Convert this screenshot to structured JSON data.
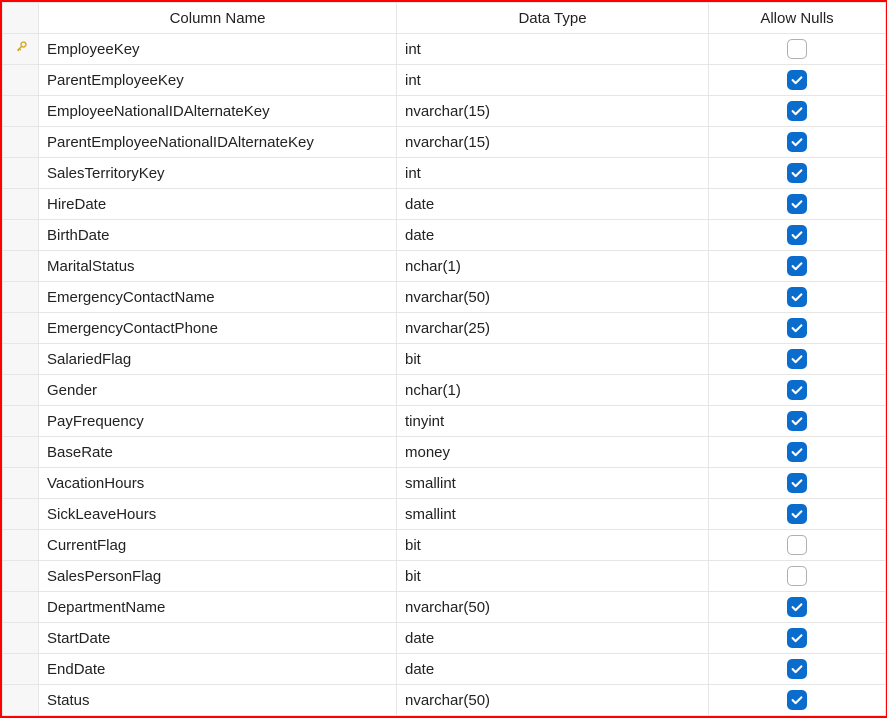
{
  "headers": {
    "columnName": "Column Name",
    "dataType": "Data Type",
    "allowNulls": "Allow Nulls"
  },
  "rows": [
    {
      "isKey": true,
      "name": "EmployeeKey",
      "type": "int",
      "allowNulls": false
    },
    {
      "isKey": false,
      "name": "ParentEmployeeKey",
      "type": "int",
      "allowNulls": true
    },
    {
      "isKey": false,
      "name": "EmployeeNationalIDAlternateKey",
      "type": "nvarchar(15)",
      "allowNulls": true
    },
    {
      "isKey": false,
      "name": "ParentEmployeeNationalIDAlternateKey",
      "type": "nvarchar(15)",
      "allowNulls": true
    },
    {
      "isKey": false,
      "name": "SalesTerritoryKey",
      "type": "int",
      "allowNulls": true
    },
    {
      "isKey": false,
      "name": "HireDate",
      "type": "date",
      "allowNulls": true
    },
    {
      "isKey": false,
      "name": "BirthDate",
      "type": "date",
      "allowNulls": true
    },
    {
      "isKey": false,
      "name": "MaritalStatus",
      "type": "nchar(1)",
      "allowNulls": true
    },
    {
      "isKey": false,
      "name": "EmergencyContactName",
      "type": "nvarchar(50)",
      "allowNulls": true
    },
    {
      "isKey": false,
      "name": "EmergencyContactPhone",
      "type": "nvarchar(25)",
      "allowNulls": true
    },
    {
      "isKey": false,
      "name": "SalariedFlag",
      "type": "bit",
      "allowNulls": true
    },
    {
      "isKey": false,
      "name": "Gender",
      "type": "nchar(1)",
      "allowNulls": true
    },
    {
      "isKey": false,
      "name": "PayFrequency",
      "type": "tinyint",
      "allowNulls": true
    },
    {
      "isKey": false,
      "name": "BaseRate",
      "type": "money",
      "allowNulls": true
    },
    {
      "isKey": false,
      "name": "VacationHours",
      "type": "smallint",
      "allowNulls": true
    },
    {
      "isKey": false,
      "name": "SickLeaveHours",
      "type": "smallint",
      "allowNulls": true
    },
    {
      "isKey": false,
      "name": "CurrentFlag",
      "type": "bit",
      "allowNulls": false
    },
    {
      "isKey": false,
      "name": "SalesPersonFlag",
      "type": "bit",
      "allowNulls": false
    },
    {
      "isKey": false,
      "name": "DepartmentName",
      "type": "nvarchar(50)",
      "allowNulls": true
    },
    {
      "isKey": false,
      "name": "StartDate",
      "type": "date",
      "allowNulls": true
    },
    {
      "isKey": false,
      "name": "EndDate",
      "type": "date",
      "allowNulls": true
    },
    {
      "isKey": false,
      "name": "Status",
      "type": "nvarchar(50)",
      "allowNulls": true
    }
  ]
}
